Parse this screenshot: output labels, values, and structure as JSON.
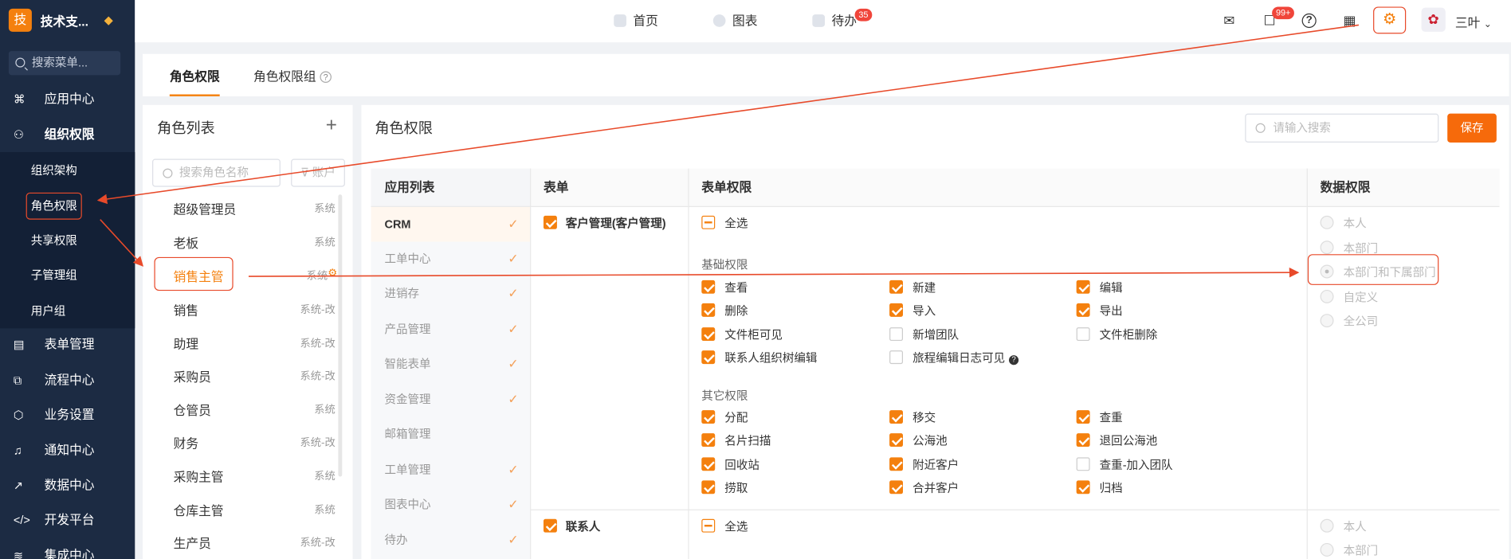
{
  "sidebar": {
    "logo_char": "技",
    "brand": "技术支...",
    "search_placeholder": "搜索菜单...",
    "items": [
      {
        "label": "应用中心",
        "icon": "apps-icon"
      },
      {
        "label": "组织权限",
        "icon": "user-icon"
      },
      {
        "label": "表单管理",
        "icon": "form-icon"
      },
      {
        "label": "流程中心",
        "icon": "flow-icon"
      },
      {
        "label": "业务设置",
        "icon": "cube-icon"
      },
      {
        "label": "通知中心",
        "icon": "bell-icon"
      },
      {
        "label": "数据中心",
        "icon": "chart-icon"
      },
      {
        "label": "开发平台",
        "icon": "code-icon"
      },
      {
        "label": "集成中心",
        "icon": "layers-icon"
      }
    ],
    "subitems": [
      "组织架构",
      "角色权限",
      "共享权限",
      "子管理组",
      "用户组"
    ]
  },
  "header": {
    "tabs": [
      {
        "label": "首页"
      },
      {
        "label": "图表"
      },
      {
        "label": "待办",
        "badge": "35"
      }
    ],
    "chat_badge": "99+",
    "user_name": "三叶"
  },
  "page_tabs": [
    "角色权限",
    "角色权限组"
  ],
  "roles": {
    "title": "角色列表",
    "add": "+",
    "search_placeholder": "搜索角色名称",
    "filter_label": "账户",
    "items": [
      {
        "name": "超级管理员",
        "tag": "系统"
      },
      {
        "name": "老板",
        "tag": "系统"
      },
      {
        "name": "销售主管",
        "tag": "系统"
      },
      {
        "name": "销售",
        "tag": "系统-改"
      },
      {
        "name": "助理",
        "tag": "系统-改"
      },
      {
        "name": "采购员",
        "tag": "系统-改"
      },
      {
        "name": "仓管员",
        "tag": "系统"
      },
      {
        "name": "财务",
        "tag": "系统-改"
      },
      {
        "name": "采购主管",
        "tag": "系统"
      },
      {
        "name": "仓库主管",
        "tag": "系统"
      },
      {
        "name": "生产员",
        "tag": "系统-改"
      }
    ]
  },
  "main": {
    "title": "角色权限",
    "search_placeholder": "请输入搜索",
    "save_label": "保存",
    "columns": [
      "应用列表",
      "表单",
      "表单权限",
      "数据权限"
    ],
    "apps": [
      "CRM",
      "工单中心",
      "进销存",
      "产品管理",
      "智能表单",
      "资金管理",
      "邮箱管理",
      "工单管理",
      "图表中心",
      "待办"
    ],
    "forms": [
      {
        "name": "客户管理(客户管理)",
        "checked": true
      },
      {
        "name": "联系人",
        "checked": true
      }
    ],
    "select_all": "全选",
    "basic_label": "基础权限",
    "basic_perms": [
      {
        "label": "查看",
        "checked": true
      },
      {
        "label": "新建",
        "checked": true
      },
      {
        "label": "编辑",
        "checked": true
      },
      {
        "label": "删除",
        "checked": true
      },
      {
        "label": "导入",
        "checked": true
      },
      {
        "label": "导出",
        "checked": true
      },
      {
        "label": "文件柜可见",
        "checked": true
      },
      {
        "label": "新增团队",
        "checked": false
      },
      {
        "label": "文件柜删除",
        "checked": false
      },
      {
        "label": "联系人组织树编辑",
        "checked": true
      },
      {
        "label": "旅程编辑日志可见",
        "checked": false
      }
    ],
    "other_label": "其它权限",
    "other_perms": [
      {
        "label": "分配",
        "checked": true
      },
      {
        "label": "移交",
        "checked": true
      },
      {
        "label": "查重",
        "checked": true
      },
      {
        "label": "名片扫描",
        "checked": true
      },
      {
        "label": "公海池",
        "checked": true
      },
      {
        "label": "退回公海池",
        "checked": true
      },
      {
        "label": "回收站",
        "checked": true
      },
      {
        "label": "附近客户",
        "checked": true
      },
      {
        "label": "查重-加入团队",
        "checked": false
      },
      {
        "label": "捞取",
        "checked": true
      },
      {
        "label": "合并客户",
        "checked": true
      },
      {
        "label": "归档",
        "checked": true
      }
    ],
    "data_scopes": [
      "本人",
      "本部门",
      "本部门和下属部门",
      "自定义",
      "全公司"
    ],
    "data_selected": "本部门和下属部门"
  }
}
